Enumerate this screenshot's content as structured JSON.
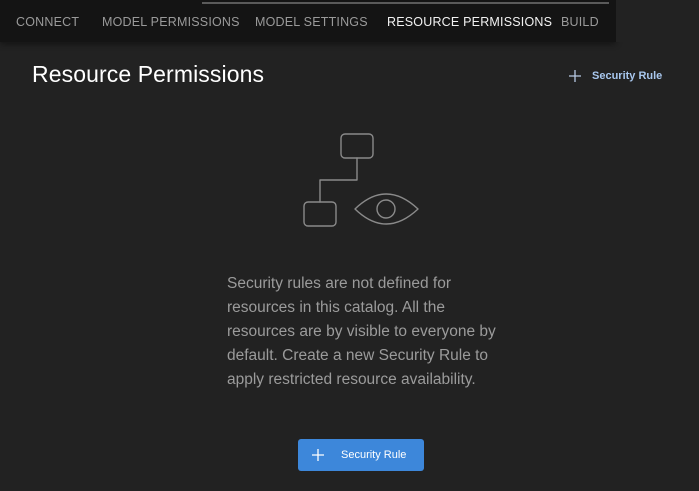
{
  "tabs": [
    {
      "label": "CONNECT",
      "active": false
    },
    {
      "label": "MODEL PERMISSIONS",
      "active": false
    },
    {
      "label": "MODEL SETTINGS",
      "active": false
    },
    {
      "label": "RESOURCE PERMISSIONS",
      "active": true
    },
    {
      "label": "BUILD",
      "active": false
    }
  ],
  "page": {
    "title": "Resource Permissions"
  },
  "header_action": {
    "label": "Security Rule",
    "icon": "plus-icon"
  },
  "empty_state": {
    "illustration_icon": "flowchart-eye-icon",
    "message": "Security rules are not defined for resources in this catalog. All the resources are by visible to everyone by default. Create a new Security Rule to apply restricted resource availability.",
    "button_label": "Security Rule",
    "button_icon": "plus-icon"
  },
  "colors": {
    "background": "#222222",
    "tabbar": "#141414",
    "accent": "#3d87da",
    "link": "#a8c7ee"
  }
}
